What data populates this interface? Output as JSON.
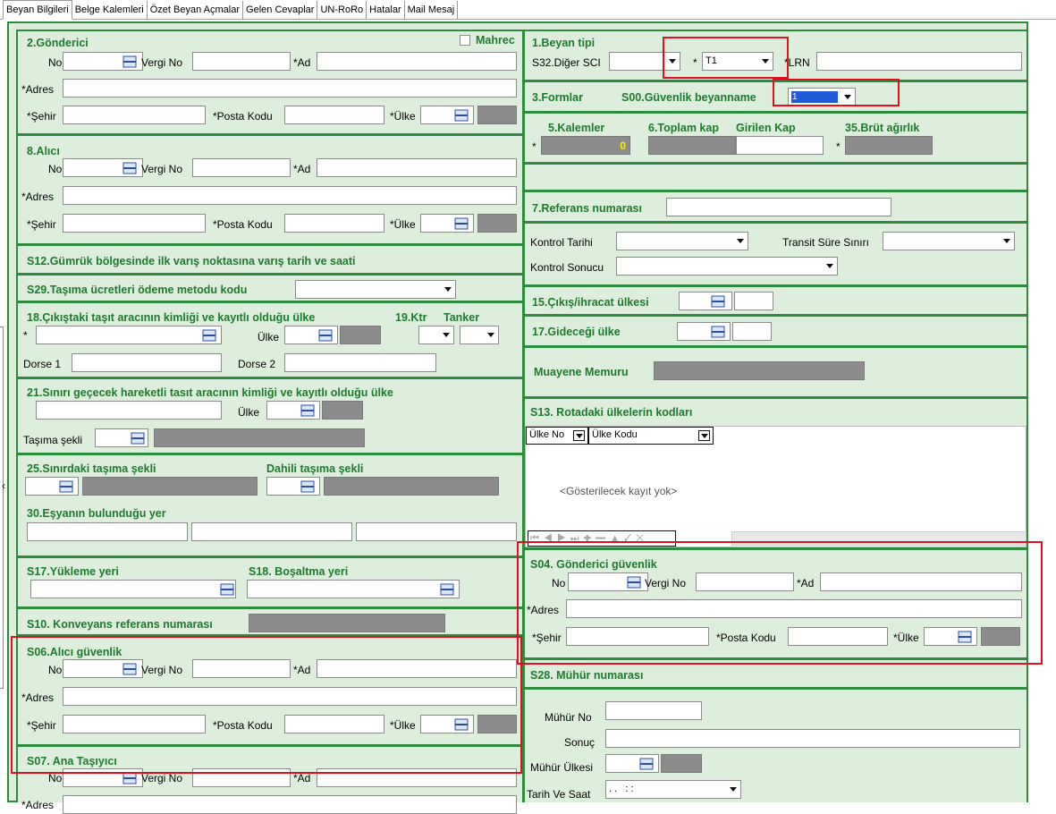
{
  "tabs": [
    "Beyan Bilgileri",
    "Belge Kalemleri",
    "Özet Beyan Açmalar",
    "Gelen Cevaplar",
    "UN-RoRo",
    "Hatalar",
    "Mail Mesaj"
  ],
  "colors": {
    "section_border": "#2d8c3b",
    "panel_bg": "#ddeedd",
    "title_green": "#1e7a2d",
    "highlight_red": "#e01020",
    "readonly_grey": "#8c8c8c",
    "count_yellow": "#ffee00"
  },
  "left": {
    "gonderici": {
      "title": "2.Gönderici",
      "mahrec": "Mahrec",
      "no": "No",
      "vergi_no": "Vergi No",
      "ad": "*Ad",
      "adres": "*Adres",
      "sehir": "*Şehir",
      "posta_kodu": "*Posta Kodu",
      "ulke": "*Ülke"
    },
    "alici": {
      "title": "8.Alıcı",
      "no": "No",
      "vergi_no": "Vergi No",
      "ad": "*Ad",
      "adres": "*Adres",
      "sehir": "*Şehir",
      "posta_kodu": "*Posta Kodu",
      "ulke": "*Ülke"
    },
    "s12": {
      "title": "S12.Gümrük bölgesinde ilk varış noktasına varış tarih ve saati"
    },
    "s29": {
      "title": "S29.Taşıma ücretleri ödeme metodu kodu"
    },
    "tasit18": {
      "title": "18.Çıkıştaki taşıt aracının kimliği ve kayıtlı olduğu ülke",
      "ktr": "19.Ktr",
      "tanker": "Tanker",
      "star": "*",
      "ulke": "Ülke",
      "dorse1": "Dorse 1",
      "dorse2": "Dorse 2"
    },
    "tasit21": {
      "title": "21.Sınırı geçecek hareketli tasıt aracının kimliği ve kayıtlı olduğu ülke",
      "ulke": "Ülke",
      "tasima_sekli": "Taşıma şekli"
    },
    "s25": {
      "title": "25.Sınırdaki taşıma şekli",
      "dahili": "Dahili taşıma şekli"
    },
    "s30": {
      "title": "30.Eşyanın bulunduğu yer"
    },
    "s17": {
      "title": "S17.Yükleme yeri",
      "s18": "S18. Boşaltma yeri"
    },
    "s10": {
      "title": "S10. Konveyans referans numarası"
    },
    "s06": {
      "title": "S06.Alıcı güvenlik",
      "no": "No",
      "vergi_no": "Vergi No",
      "ad": "*Ad",
      "adres": "*Adres",
      "sehir": "*Şehir",
      "posta_kodu": "*Posta Kodu",
      "ulke": "*Ülke"
    },
    "s07": {
      "title": "S07. Ana Taşıyıcı",
      "no": "No",
      "vergi_no": "Vergi No",
      "ad": "*Ad",
      "adres": "*Adres"
    }
  },
  "right": {
    "beyan_tipi": {
      "title": "1.Beyan tipi",
      "s32": "S32.Diğer SCI",
      "star": "*",
      "tip_value": "T1",
      "lrn": "*LRN"
    },
    "formlar": {
      "title": "3.Formlar",
      "s00": "S00.Güvenlik beyanname",
      "s00_value": "1"
    },
    "kalemler": {
      "kalemler": "5.Kalemler",
      "toplam_kap": "6.Toplam kap",
      "girilen_kap": "Girilen Kap",
      "brut": "35.Brüt ağırlık",
      "star": "*",
      "count": "0"
    },
    "referans": {
      "title": "7.Referans numarası"
    },
    "kontrol": {
      "tarihi": "Kontrol Tarihi",
      "transit": "Transit Süre Sınırı",
      "sonucu": "Kontrol Sonucu"
    },
    "cikis": {
      "title": "15.Çıkış/ihracat ülkesi"
    },
    "gidecegi": {
      "title": "17.Gideceği ülke"
    },
    "muayene": {
      "title": "Muayene Memuru"
    },
    "s13": {
      "title": "S13. Rotadaki ülkelerin kodları",
      "col1": "Ülke No",
      "col2": "Ülke Kodu",
      "empty": "<Gösterilecek kayıt yok>",
      "nav": "⏮ ◀ ▶ ⏭ ✚ ━ ▲ ✓ ✕"
    },
    "s04": {
      "title": "S04. Gönderici güvenlik",
      "no": "No",
      "vergi_no": "Vergi No",
      "ad": "*Ad",
      "adres": "*Adres",
      "sehir": "*Şehir",
      "posta_kodu": "*Posta Kodu",
      "ulke": "*Ülke"
    },
    "s28": {
      "title": "S28. Mühür numarası",
      "muhur_no": "Mühür No",
      "sonuc": "Sonuç",
      "muhur_ulkesi": "Mühür Ülkesi",
      "tarih_saat": "Tarih Ve Saat",
      "tarih_value": ". .   : :"
    }
  }
}
